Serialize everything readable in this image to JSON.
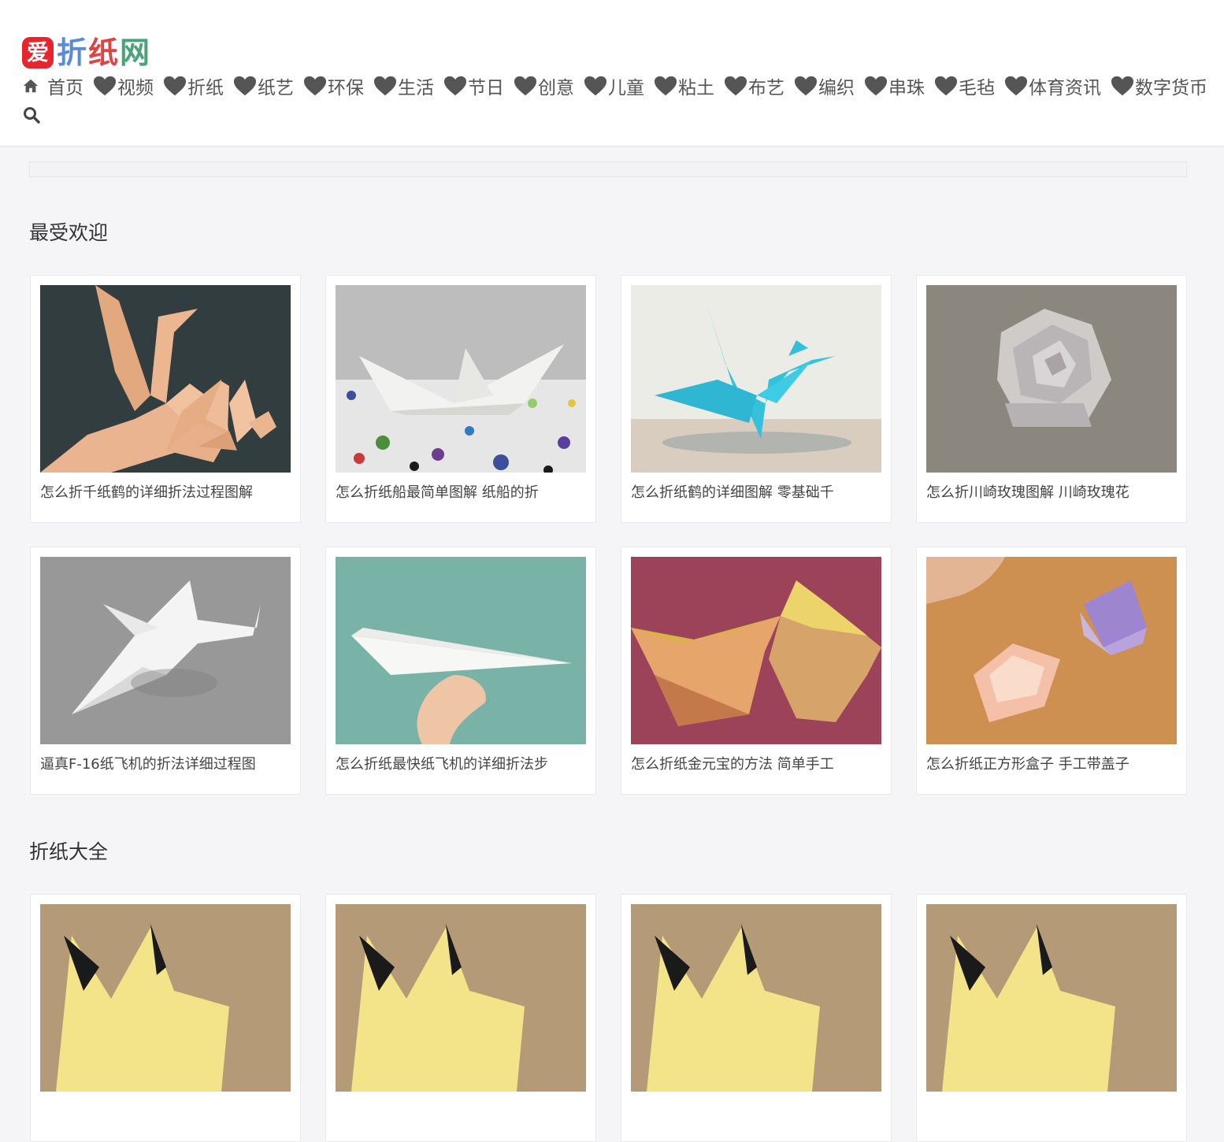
{
  "brand": {
    "badge": "爱",
    "name_chars": [
      "折",
      "纸",
      "网"
    ],
    "colors": [
      "#e8242c",
      "#5b8bd6",
      "#d44",
      "#4aa37a"
    ]
  },
  "nav": {
    "home": "首页",
    "items": [
      "视频",
      "折纸",
      "纸艺",
      "环保",
      "生活",
      "节日",
      "创意",
      "儿童",
      "粘土",
      "布艺",
      "编织",
      "串珠",
      "毛毡",
      "体育资讯",
      "数字货币"
    ]
  },
  "sections": {
    "popular": {
      "title": "最受欢迎",
      "cards": [
        {
          "title": "怎么折千纸鹤的详细折法过程图解",
          "image": "paper-cranes-photo"
        },
        {
          "title": "怎么折纸船最简单图解 纸船的折",
          "image": "paper-boat-photo"
        },
        {
          "title": "怎么折纸鹤的详细图解 零基础千",
          "image": "blue-paper-crane-photo"
        },
        {
          "title": "怎么折川崎玫瑰图解 川崎玫瑰花",
          "image": "kawasaki-rose-photo"
        },
        {
          "title": "逼真F-16纸飞机的折法详细过程图",
          "image": "f16-paper-plane-photo"
        },
        {
          "title": "怎么折纸最快纸飞机的详细折法步",
          "image": "paper-airplane-photo"
        },
        {
          "title": "怎么折纸金元宝的方法 简单手工",
          "image": "gold-ingot-photo"
        },
        {
          "title": "怎么折纸正方形盒子 手工带盖子",
          "image": "paper-box-photo"
        }
      ]
    },
    "all": {
      "title": "折纸大全",
      "cards": [
        {
          "image": "pikachu-paper-photo"
        },
        {
          "image": "pikachu-paper-photo"
        },
        {
          "image": "pikachu-paper-photo"
        },
        {
          "image": "pikachu-paper-photo"
        }
      ]
    }
  }
}
